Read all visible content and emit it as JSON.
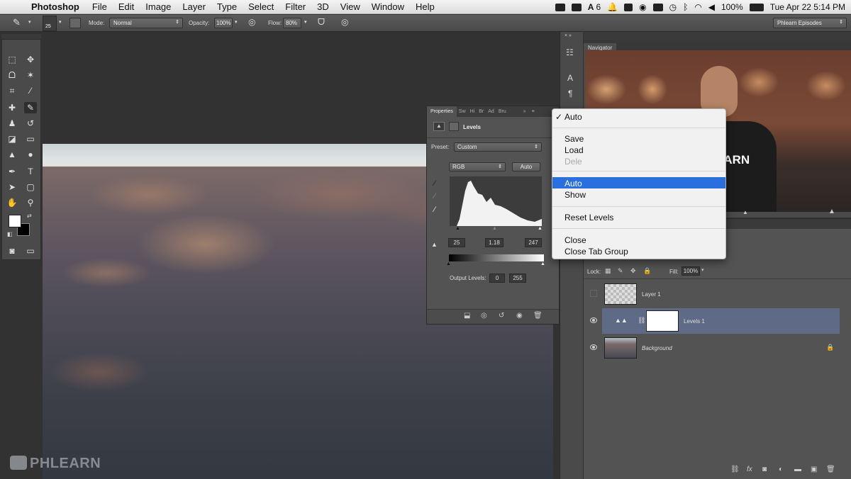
{
  "menubar": {
    "app": "Photoshop",
    "items": [
      "File",
      "Edit",
      "Image",
      "Layer",
      "Type",
      "Select",
      "Filter",
      "3D",
      "View",
      "Window",
      "Help"
    ],
    "status_number": "6",
    "battery": "100%",
    "datetime": "Tue Apr 22  5:14 PM"
  },
  "options": {
    "brush_size": "25",
    "mode_label": "Mode:",
    "mode_value": "Normal",
    "opacity_label": "Opacity:",
    "opacity_value": "100%",
    "flow_label": "Flow:",
    "flow_value": "80%",
    "workspace": "Phlearn Episodes"
  },
  "properties": {
    "tabs": [
      "Properties",
      "Sw",
      "Hi",
      "Br",
      "Ad",
      "Bru"
    ],
    "title": "Levels",
    "preset_label": "Preset:",
    "preset_value": "Custom",
    "channel": "RGB",
    "auto_label": "Auto",
    "input_black": "25",
    "input_gamma": "1.18",
    "input_white": "247",
    "output_label": "Output Levels:",
    "output_black": "0",
    "output_white": "255"
  },
  "dropdown": {
    "items": [
      "Auto",
      "Save",
      "Load",
      "Dele",
      "Auto",
      "Show",
      "Reset Levels",
      "Close",
      "Close Tab Group"
    ],
    "checked_item": "✓"
  },
  "navigator": {
    "title": "Navigator",
    "shirt_text": "PHLEARN"
  },
  "layers": {
    "lock_label": "Lock:",
    "fill_label": "Fill:",
    "fill_value": "100%",
    "rows": [
      {
        "name": "Layer 1",
        "visible": false
      },
      {
        "name": "Levels 1",
        "visible": true,
        "selected": true
      },
      {
        "name": "Background",
        "visible": true,
        "locked": true
      }
    ]
  },
  "watermark": "PHLEARN"
}
